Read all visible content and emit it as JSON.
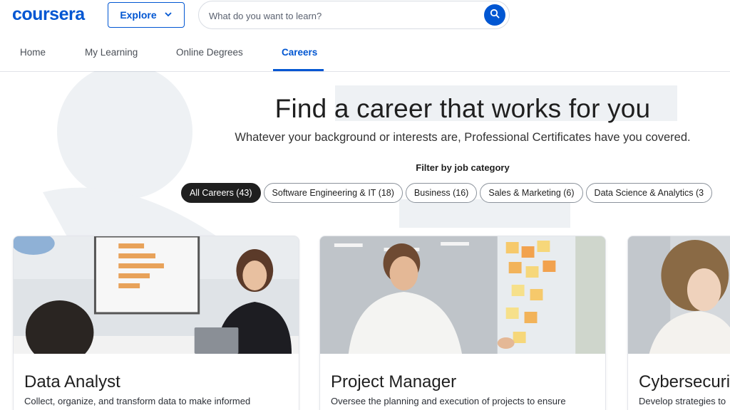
{
  "header": {
    "logo": "coursera",
    "explore_label": "Explore",
    "search_placeholder": "What do you want to learn?"
  },
  "nav": {
    "items": [
      {
        "label": "Home"
      },
      {
        "label": "My Learning"
      },
      {
        "label": "Online Degrees"
      },
      {
        "label": "Careers"
      }
    ],
    "active": "Careers"
  },
  "hero": {
    "title": "Find a career that works for you",
    "subtitle": "Whatever your background or interests are, Professional Certificates have you covered."
  },
  "filters": {
    "label": "Filter by job category",
    "chips": [
      {
        "label": "All Careers (43)"
      },
      {
        "label": "Software Engineering & IT (18)"
      },
      {
        "label": "Business (16)"
      },
      {
        "label": "Sales & Marketing (6)"
      },
      {
        "label": "Data Science & Analytics (3"
      }
    ],
    "selected": "All Careers (43)"
  },
  "cards": [
    {
      "title": "Data Analyst",
      "description": "Collect, organize, and transform data to make informed"
    },
    {
      "title": "Project Manager",
      "description": "Oversee the planning and execution of projects to ensure"
    },
    {
      "title": "Cybersecuri",
      "description": "Develop strategies to"
    }
  ],
  "colors": {
    "brand": "#0056d2",
    "text": "#1f1f1f",
    "chip_active_bg": "#1f1f1f"
  },
  "icons": {
    "explore": "chevron-down-icon",
    "search": "search-icon"
  }
}
